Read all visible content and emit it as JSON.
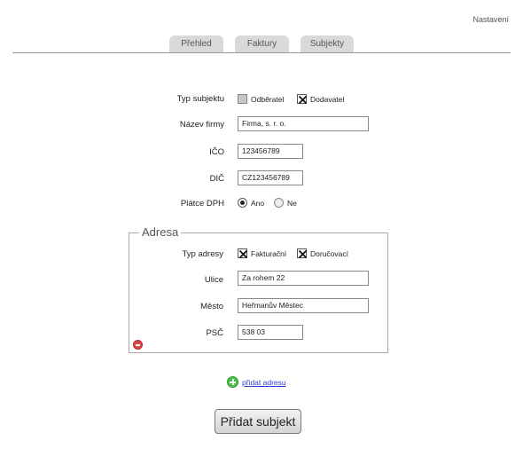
{
  "header": {
    "settings_link": "Nastavení"
  },
  "tabs": [
    {
      "label": "Přehled"
    },
    {
      "label": "Faktury"
    },
    {
      "label": "Subjekty"
    }
  ],
  "form": {
    "typ_subjektu": {
      "label": "Typ subjektu",
      "options": [
        {
          "label": "Odběratel",
          "checked": false
        },
        {
          "label": "Dodavatel",
          "checked": true
        }
      ]
    },
    "nazev_firmy": {
      "label": "Název firmy",
      "value": "Firma, s. r. o."
    },
    "ico": {
      "label": "IČO",
      "value": "123456789"
    },
    "dic": {
      "label": "DIČ",
      "value": "CZ123456789"
    },
    "platce_dph": {
      "label": "Plátce DPH",
      "options": [
        {
          "label": "Ano",
          "selected": true
        },
        {
          "label": "Ne",
          "selected": false
        }
      ]
    }
  },
  "address": {
    "legend": "Adresa",
    "typ_adresy": {
      "label": "Typ adresy",
      "options": [
        {
          "label": "Fakturační",
          "checked": true
        },
        {
          "label": "Doručovací",
          "checked": true
        }
      ]
    },
    "ulice": {
      "label": "Ulice",
      "value": "Za rohem 22"
    },
    "mesto": {
      "label": "Město",
      "value": "Heřmanův Městec"
    },
    "psc": {
      "label": "PSČ",
      "value": "538 03"
    }
  },
  "add_address_link": "přidat adresu",
  "submit_button": "Přidat subjekt"
}
